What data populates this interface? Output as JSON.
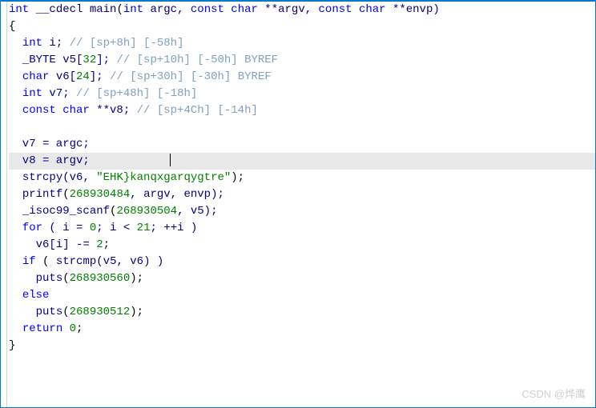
{
  "code": {
    "l1": {
      "t1": "int",
      "t2": " __cdecl ",
      "t3": "main",
      "t4": "(",
      "t5": "int",
      "t6": " argc, ",
      "t7": "const char",
      "t8": " **argv, ",
      "t9": "const char",
      "t10": " **envp)"
    },
    "l2": "{",
    "l3": {
      "t1": "  ",
      "t2": "int",
      "t3": " i; ",
      "t4": "// [sp+8h] [-58h]"
    },
    "l4": {
      "t1": "  _BYTE v5[",
      "t2": "32",
      "t3": "]; ",
      "t4": "// [sp+10h] [-50h] BYREF"
    },
    "l5": {
      "t1": "  ",
      "t2": "char",
      "t3": " v6[",
      "t4": "24",
      "t5": "]; ",
      "t6": "// [sp+30h] [-30h] BYREF"
    },
    "l6": {
      "t1": "  ",
      "t2": "int",
      "t3": " v7; ",
      "t4": "// [sp+48h] [-18h]"
    },
    "l7": {
      "t1": "  ",
      "t2": "const char",
      "t3": " **v8; ",
      "t4": "// [sp+4Ch] [-14h]"
    },
    "l8": "",
    "l9": {
      "t1": "  v7 = argc;"
    },
    "l10": {
      "t1": "  v8 = argv;"
    },
    "l11": {
      "t1": "  ",
      "t2": "strcpy",
      "t3": "(v6, ",
      "t4": "\"EHK}kanqxgarqygtre\"",
      "t5": ");"
    },
    "l12": {
      "t1": "  ",
      "t2": "printf",
      "t3": "(",
      "t4": "268930484",
      "t5": ", argv, envp);"
    },
    "l13": {
      "t1": "  ",
      "t2": "_isoc99_scanf",
      "t3": "(",
      "t4": "268930504",
      "t5": ", v5);"
    },
    "l14": {
      "t1": "  ",
      "t2": "for",
      "t3": " ( i = ",
      "t4": "0",
      "t5": "; i < ",
      "t6": "21",
      "t7": "; ++i )"
    },
    "l15": {
      "t1": "    v6[i] -= ",
      "t2": "2",
      "t3": ";"
    },
    "l16": {
      "t1": "  ",
      "t2": "if",
      "t3": " ( ",
      "t4": "strcmp",
      "t5": "(v5, v6) )"
    },
    "l17": {
      "t1": "    ",
      "t2": "puts",
      "t3": "(",
      "t4": "268930560",
      "t5": ");"
    },
    "l18": {
      "t1": "  ",
      "t2": "else"
    },
    "l19": {
      "t1": "    ",
      "t2": "puts",
      "t3": "(",
      "t4": "268930512",
      "t5": ");"
    },
    "l20": {
      "t1": "  ",
      "t2": "return",
      "t3": " ",
      "t4": "0",
      "t5": ";"
    },
    "l21": "}"
  },
  "watermark": "CSDN @烨鹰"
}
